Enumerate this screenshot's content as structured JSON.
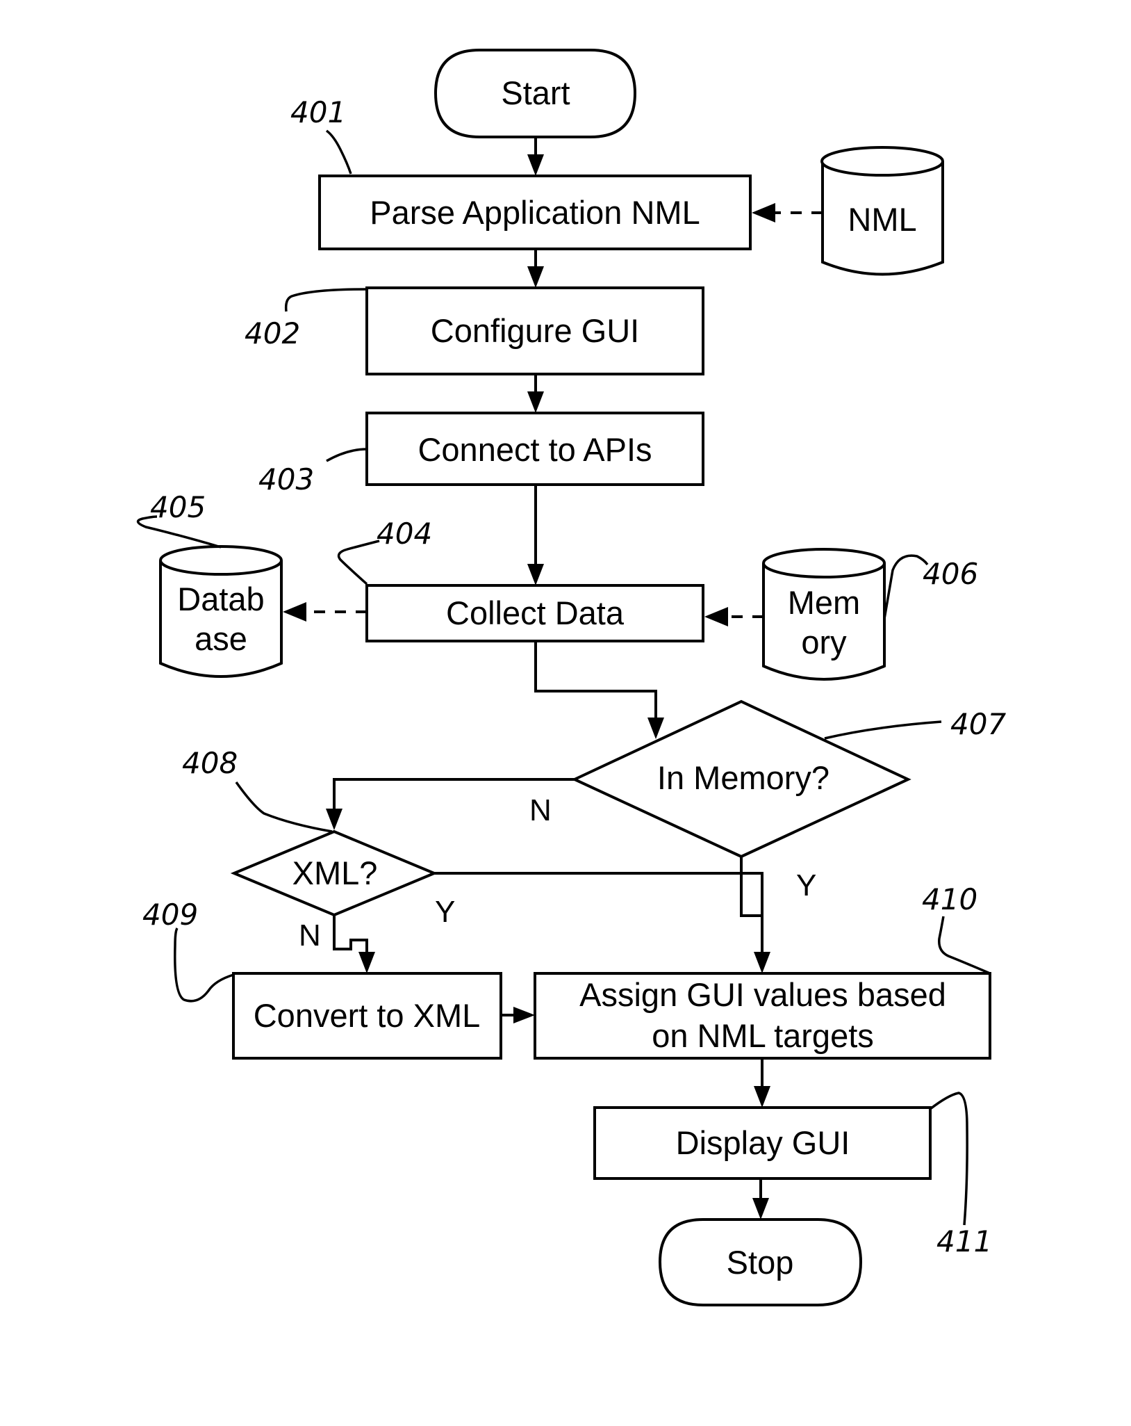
{
  "figure": {
    "nodes": {
      "start": {
        "label": "Start",
        "kind": "terminator"
      },
      "parse": {
        "label": "Parse Application NML",
        "ref": "401",
        "kind": "process"
      },
      "nml_store": {
        "label": "NML",
        "kind": "datastore"
      },
      "configure": {
        "label": "Configure GUI",
        "ref": "402",
        "kind": "process"
      },
      "connect": {
        "label": "Connect to APIs",
        "ref": "403",
        "kind": "process"
      },
      "collect": {
        "label": "Collect Data",
        "ref": "404",
        "kind": "process"
      },
      "database": {
        "label_line1": "Datab",
        "label_line2": "ase",
        "ref": "405",
        "kind": "datastore"
      },
      "memory": {
        "label_line1": "Mem",
        "label_line2": "ory",
        "ref": "406",
        "kind": "datastore"
      },
      "in_memory": {
        "label": "In Memory?",
        "ref": "407",
        "kind": "decision"
      },
      "xml": {
        "label": "XML?",
        "ref": "408",
        "kind": "decision"
      },
      "convert": {
        "label": "Convert to XML",
        "ref": "409",
        "kind": "process"
      },
      "assign": {
        "label_line1": "Assign GUI values based",
        "label_line2": "on NML targets",
        "ref": "410",
        "kind": "process"
      },
      "display": {
        "label": "Display GUI",
        "ref": "411",
        "kind": "process"
      },
      "stop": {
        "label": "Stop",
        "kind": "terminator"
      }
    },
    "edges": {
      "in_memory_no": "N",
      "in_memory_yes": "Y",
      "xml_yes": "Y",
      "xml_no": "N"
    }
  }
}
